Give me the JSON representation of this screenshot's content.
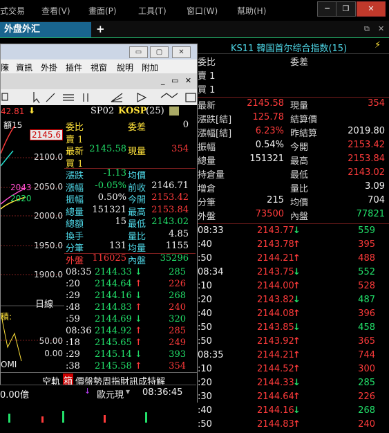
{
  "menubar": {
    "items": [
      "式交易",
      "查看(V)",
      "畫面(P)",
      "工具(T)",
      "窗口(W)",
      "幫助(H)"
    ],
    "window_buttons": [
      "─",
      "❐",
      "✕"
    ]
  },
  "tabs": {
    "active": "外盘外汇",
    "add": "+",
    "ctl1": "⧉",
    "ctl2": "✕"
  },
  "right_panel": {
    "title": "KS11 韓国首尔综合指数(15)",
    "lightning": "⚡",
    "top_rows": [
      {
        "l1": "委比",
        "l2": "委差"
      },
      {
        "l1": "賣 1"
      },
      {
        "l1": "買 1"
      }
    ],
    "stats": [
      {
        "l": "最新",
        "v": "2145.58",
        "l2": "現量",
        "v2": "354",
        "c1": "red",
        "c2": "red"
      },
      {
        "l": "漲跌[結]",
        "v": "125.78",
        "l2": "結算價",
        "v2": "",
        "c1": "red",
        "c2": "wht"
      },
      {
        "l": "漲幅[結]",
        "v": "6.23%",
        "l2": "昨結算",
        "v2": "2019.80",
        "c1": "red",
        "c2": "wht"
      },
      {
        "l": "振幅",
        "v": "0.54%",
        "l2": "今開",
        "v2": "2153.42",
        "c1": "wht",
        "c2": "red"
      },
      {
        "l": "總量",
        "v": "151321",
        "l2": "最高",
        "v2": "2153.84",
        "c1": "wht",
        "c2": "red"
      },
      {
        "l": "持倉量",
        "v": "",
        "l2": "最低",
        "v2": "2143.02",
        "c1": "wht",
        "c2": "red"
      },
      {
        "l": "增倉",
        "v": "",
        "l2": "量比",
        "v2": "3.09",
        "c1": "wht",
        "c2": "wht"
      },
      {
        "l": "分筆",
        "v": "215",
        "l2": "均價",
        "v2": "704",
        "c1": "wht",
        "c2": "wht"
      },
      {
        "l": "外盤",
        "v": "73500",
        "l2": "內盤",
        "v2": "77821",
        "c1": "red",
        "c2": "grn"
      }
    ],
    "ticks": [
      {
        "t": "08:33",
        "p": "2143.77",
        "d": "↓",
        "q": "559",
        "pc": "red",
        "dc": "grn",
        "qc": "grn"
      },
      {
        "t": ":40",
        "p": "2143.78",
        "d": "↑",
        "q": "395",
        "pc": "red",
        "dc": "red",
        "qc": "red"
      },
      {
        "t": ":50",
        "p": "2144.21",
        "d": "↑",
        "q": "488",
        "pc": "red",
        "dc": "red",
        "qc": "red"
      },
      {
        "t": "08:34",
        "p": "2143.75",
        "d": "↓",
        "q": "552",
        "pc": "red",
        "dc": "grn",
        "qc": "grn"
      },
      {
        "t": ":10",
        "p": "2144.00",
        "d": "↑",
        "q": "528",
        "pc": "red",
        "dc": "red",
        "qc": "red"
      },
      {
        "t": ":20",
        "p": "2143.82",
        "d": "↓",
        "q": "487",
        "pc": "red",
        "dc": "grn",
        "qc": "grn"
      },
      {
        "t": ":40",
        "p": "2144.08",
        "d": "↑",
        "q": "396",
        "pc": "red",
        "dc": "red",
        "qc": "red"
      },
      {
        "t": ":50",
        "p": "2143.85",
        "d": "↓",
        "q": "458",
        "pc": "red",
        "dc": "grn",
        "qc": "grn"
      },
      {
        "t": ":50",
        "p": "2143.92",
        "d": "↑",
        "q": "365",
        "pc": "red",
        "dc": "red",
        "qc": "red"
      },
      {
        "t": "08:35",
        "p": "2144.21",
        "d": "↑",
        "q": "744",
        "pc": "red",
        "dc": "red",
        "qc": "red"
      },
      {
        "t": ":10",
        "p": "2144.52",
        "d": "↑",
        "q": "300",
        "pc": "red",
        "dc": "red",
        "qc": "red"
      },
      {
        "t": ":20",
        "p": "2144.33",
        "d": "↓",
        "q": "285",
        "pc": "red",
        "dc": "grn",
        "qc": "grn"
      },
      {
        "t": ":30",
        "p": "2144.64",
        "d": "↑",
        "q": "226",
        "pc": "red",
        "dc": "red",
        "qc": "red"
      },
      {
        "t": ":40",
        "p": "2144.16",
        "d": "↓",
        "q": "268",
        "pc": "red",
        "dc": "grn",
        "qc": "grn"
      },
      {
        "t": ":50",
        "p": "2144.83",
        "d": "↑",
        "q": "240",
        "pc": "red",
        "dc": "red",
        "qc": "red"
      }
    ]
  },
  "window": {
    "title_buttons": [
      "▭",
      "▢",
      "✕"
    ],
    "menus": [
      "陳",
      "資訊",
      "外掛",
      "插件",
      "視窗",
      "說明",
      "附加"
    ],
    "mini_btns": [
      "_",
      "▭",
      "✕"
    ],
    "chart": {
      "top_left": "42.81",
      "down_icon": "⬇",
      "label": "額15",
      "price_tag": "2145.6",
      "yticks": [
        "2100.0",
        "2050.0",
        "2000.0",
        "1950.0",
        "1900.0"
      ],
      "level_a": "2043",
      "level_b": "2020",
      "tab_daily": "日線",
      "side_label": "積:",
      "vol_ticks": [
        "50.00",
        "0.00"
      ],
      "bottom_left": "OMI"
    },
    "quote": {
      "header": {
        "code": "SP02",
        "sym": "KOSP",
        "num": "(25)"
      },
      "rows": [
        {
          "l": "委比",
          "v": "",
          "l2": "委差",
          "v2": "0",
          "lc": "yel",
          "vc": "wht",
          "l2c": "yel",
          "v2c": "wht"
        },
        {
          "l": "賣 1",
          "v": "",
          "l2": "",
          "v2": "",
          "lc": "yel",
          "vc": "wht",
          "l2c": "yel",
          "v2c": "wht"
        },
        {
          "l": "最新",
          "v": "2145.58",
          "l2": "現量",
          "v2": "354",
          "lc": "yel",
          "vc": "grn",
          "l2c": "yel",
          "v2c": "red"
        },
        {
          "l": "買 1",
          "v": "",
          "l2": "",
          "v2": "",
          "lc": "yel",
          "vc": "wht",
          "l2c": "yel",
          "v2c": "wht"
        },
        {
          "l": "漲跌",
          "v": "-1.13",
          "l2": "均價",
          "v2": "",
          "lc": "cyan",
          "vc": "grn",
          "l2c": "cyan",
          "v2c": "wht"
        },
        {
          "l": "漲幅",
          "v": "-0.05%",
          "l2": "前收",
          "v2": "2146.71",
          "lc": "cyan",
          "vc": "grn",
          "l2c": "cyan",
          "v2c": "wht"
        },
        {
          "l": "振幅",
          "v": "0.50%",
          "l2": "今開",
          "v2": "2153.42",
          "lc": "cyan",
          "vc": "wht",
          "l2c": "cyan",
          "v2c": "red"
        },
        {
          "l": "總量",
          "v": "151321",
          "l2": "最高",
          "v2": "2153.84",
          "lc": "cyan",
          "vc": "wht",
          "l2c": "cyan",
          "v2c": "red"
        },
        {
          "l": "總額",
          "v": "15",
          "l2": "最低",
          "v2": "2143.02",
          "lc": "cyan",
          "vc": "wht",
          "l2c": "cyan",
          "v2c": "grn"
        },
        {
          "l": "換手",
          "v": "",
          "l2": "量比",
          "v2": "4.85",
          "lc": "cyan",
          "vc": "wht",
          "l2c": "cyan",
          "v2c": "wht"
        },
        {
          "l": "分筆",
          "v": "131",
          "l2": "均量",
          "v2": "1155",
          "lc": "cyan",
          "vc": "wht",
          "l2c": "cyan",
          "v2c": "wht"
        },
        {
          "l": "外盤",
          "v": "116025",
          "l2": "內盤",
          "v2": "35296",
          "lc": "red",
          "vc": "red",
          "l2c": "cyan",
          "v2c": "grn"
        }
      ],
      "ticks": [
        {
          "t": "08:35",
          "p": "2144.33",
          "d": "↓",
          "q": "285",
          "dc": "grn",
          "qc": "grn"
        },
        {
          "t": ":20",
          "p": "2144.64",
          "d": "↑",
          "q": "226",
          "dc": "red",
          "qc": "red"
        },
        {
          "t": ":29",
          "p": "2144.16",
          "d": "↓",
          "q": "268",
          "dc": "grn",
          "qc": "grn"
        },
        {
          "t": ":48",
          "p": "2144.83",
          "d": "↑",
          "q": "240",
          "dc": "red",
          "qc": "red"
        },
        {
          "t": ":59",
          "p": "2144.69",
          "d": "↓",
          "q": "320",
          "dc": "grn",
          "qc": "grn"
        },
        {
          "t": "08:36",
          "p": "2144.92",
          "d": "↑",
          "q": "285",
          "dc": "red",
          "qc": "red"
        },
        {
          "t": ":18",
          "p": "2145.65",
          "d": "↑",
          "q": "249",
          "dc": "red",
          "qc": "red"
        },
        {
          "t": ":29",
          "p": "2145.14",
          "d": "↓",
          "q": "393",
          "dc": "grn",
          "qc": "grn"
        },
        {
          "t": ":38",
          "p": "2145.58",
          "d": "↑",
          "q": "354",
          "dc": "red",
          "qc": "red"
        }
      ]
    },
    "status_tabs": "空軌",
    "status_tabs_hl": "箱",
    "status_rest": "價盤勢周指財訊成特解",
    "bottom_bar_amount": "0.00億",
    "bottom_bar_status": "歐元現",
    "bottom_bar_arrow": "↓",
    "bottom_bar_time": "08:36:45"
  },
  "colors": {
    "red": "#ff3b3b",
    "green": "#22e06a",
    "cyan": "#4fd9e9",
    "yellow": "#ffe23a",
    "tab": "#19658f"
  }
}
